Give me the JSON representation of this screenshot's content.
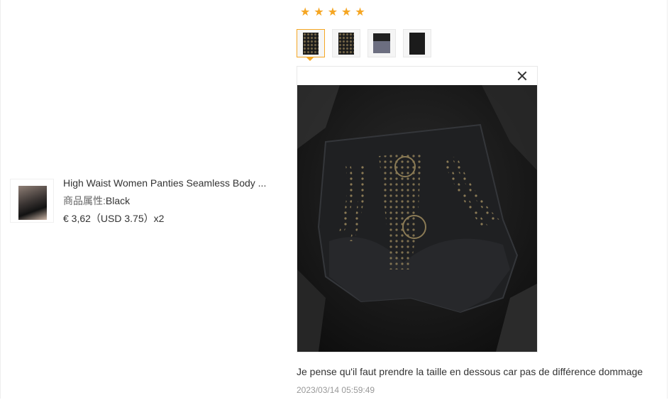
{
  "product": {
    "title": "High Waist Women Panties Seamless Body ...",
    "attr_label": "商品属性:",
    "attr_value": "Black",
    "price": "€ 3,62（USD  3.75）x2"
  },
  "review": {
    "rating": 5,
    "stars": [
      "★",
      "★",
      "★",
      "★",
      "★"
    ],
    "text": "Je pense qu'il faut prendre la taille en dessous car pas de différence dommage",
    "date": "2023/03/14 05:59:49"
  },
  "colors": {
    "star": "#f5a623",
    "active_thumb_border": "#f5a623",
    "date_text": "#999999"
  },
  "icons": {
    "close": "close-icon",
    "star": "star-icon"
  }
}
